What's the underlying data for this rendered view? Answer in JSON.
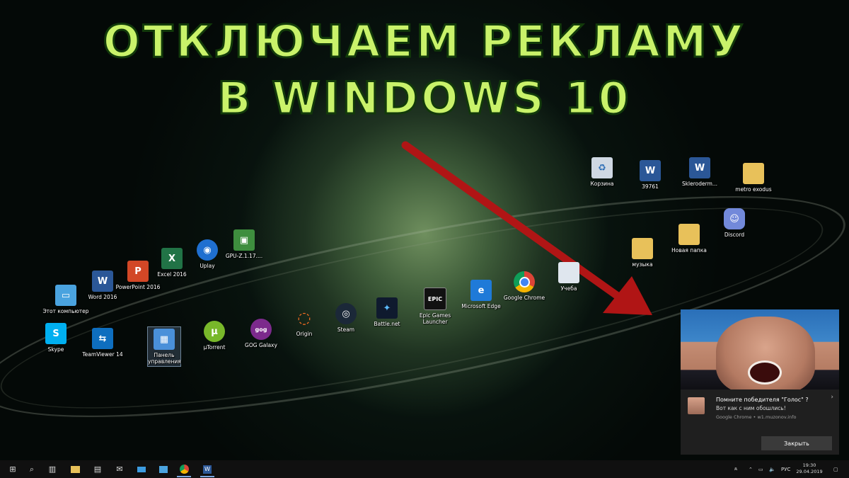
{
  "headline": {
    "line1": "ОТКЛЮЧАЕМ РЕКЛАМУ",
    "line2": "В WINDOWS 10"
  },
  "desktop_icons": [
    {
      "name": "icon-recycle-bin",
      "label": "Корзина",
      "icon": "recycle-bin-icon",
      "color": "#cfd8e3"
    },
    {
      "name": "icon-39761",
      "label": "39761",
      "icon": "word-document-icon",
      "color": "#2b5797"
    },
    {
      "name": "icon-skleroderm",
      "label": "Skleroderm...",
      "icon": "word-document-icon",
      "color": "#2b5797"
    },
    {
      "name": "icon-metro-exodus",
      "label": "metro exodus",
      "icon": "folder-icon",
      "color": "#e8c15a"
    },
    {
      "name": "icon-discord",
      "label": "Discord",
      "icon": "discord-icon",
      "color": "#7289da"
    },
    {
      "name": "icon-new-folder",
      "label": "Новая папка",
      "icon": "folder-icon",
      "color": "#e8c15a"
    },
    {
      "name": "icon-music",
      "label": "музыка",
      "icon": "folder-icon",
      "color": "#e8c15a"
    },
    {
      "name": "icon-study",
      "label": "Учеба",
      "icon": "folder-icon",
      "color": "#dfe6ee"
    },
    {
      "name": "icon-google-chrome",
      "label": "Google Chrome",
      "icon": "chrome-icon",
      "color": "#e0e0e0"
    },
    {
      "name": "icon-edge",
      "label": "Microsoft Edge",
      "icon": "edge-icon",
      "color": "#1f7ad8"
    },
    {
      "name": "icon-epic",
      "label": "Epic Games Launcher",
      "icon": "epic-games-icon",
      "color": "#111111"
    },
    {
      "name": "icon-battlenet",
      "label": "Battle.net",
      "icon": "battlenet-icon",
      "color": "#0f1a2e"
    },
    {
      "name": "icon-steam",
      "label": "Steam",
      "icon": "steam-icon",
      "color": "#1b2838"
    },
    {
      "name": "icon-origin",
      "label": "Origin",
      "icon": "origin-icon",
      "color": "#f26c22"
    },
    {
      "name": "icon-gog",
      "label": "GOG Galaxy",
      "icon": "gog-icon",
      "color": "#7c2a8c"
    },
    {
      "name": "icon-utorrent",
      "label": "µTorrent",
      "icon": "utorrent-icon",
      "color": "#78b82a"
    },
    {
      "name": "icon-control-panel",
      "label": "Панель управления",
      "icon": "control-panel-icon",
      "color": "#4a90d9"
    },
    {
      "name": "icon-teamviewer",
      "label": "TeamViewer 14",
      "icon": "teamviewer-icon",
      "color": "#0e6ebf"
    },
    {
      "name": "icon-skype",
      "label": "Skype",
      "icon": "skype-icon",
      "color": "#00aff0"
    },
    {
      "name": "icon-this-pc",
      "label": "Этот компьютер",
      "icon": "computer-icon",
      "color": "#4aa3df"
    },
    {
      "name": "icon-word",
      "label": "Word 2016",
      "icon": "word-icon",
      "color": "#2b5797"
    },
    {
      "name": "icon-powerpoint",
      "label": "PowerPoint 2016",
      "icon": "powerpoint-icon",
      "color": "#d24726"
    },
    {
      "name": "icon-excel",
      "label": "Excel 2016",
      "icon": "excel-icon",
      "color": "#217346"
    },
    {
      "name": "icon-uplay",
      "label": "Uplay",
      "icon": "uplay-icon",
      "color": "#1f6fd0"
    },
    {
      "name": "icon-gpuz",
      "label": "GPU-Z.1.17....",
      "icon": "gpuz-icon",
      "color": "#3e8e3e"
    }
  ],
  "notification": {
    "title": "Помните победителя \"Голос\" ?",
    "message": "Вот как с ним обошлись!",
    "source": "Google Chrome • w1.muzonov.info",
    "close_label": "Закрыть",
    "chevron": "›"
  },
  "taskbar": {
    "start_glyph": "⊞",
    "search_glyph": "⌕",
    "language": "РУС",
    "time": "19:30",
    "date": "29.04.2019"
  },
  "colors": {
    "headline": "#c9f26a",
    "arrow": "#b01515",
    "taskbar": "#101010"
  }
}
